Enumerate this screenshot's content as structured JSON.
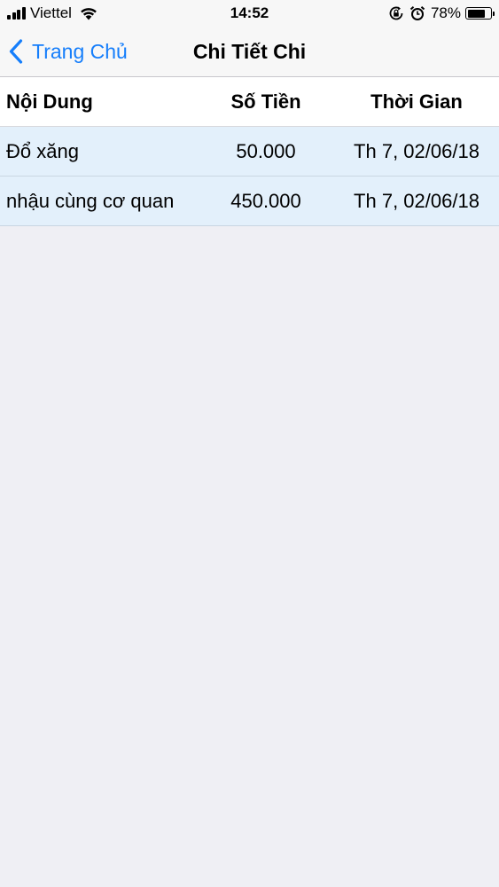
{
  "status_bar": {
    "carrier": "Viettel",
    "time": "14:52",
    "battery_percent": "78%",
    "battery_level": 0.78,
    "signal_icon": "signal-bars-icon",
    "wifi_icon": "wifi-icon",
    "rotation_lock_icon": "rotation-lock-icon",
    "alarm_icon": "alarm-clock-icon",
    "battery_icon": "battery-icon"
  },
  "nav": {
    "back_label": "Trang Chủ",
    "back_icon": "chevron-left-icon",
    "title": "Chi Tiết Chi"
  },
  "table": {
    "headers": {
      "content": "Nội Dung",
      "amount": "Số Tiền",
      "time": "Thời Gian"
    },
    "rows": [
      {
        "content": "Đổ xăng",
        "amount": "50.000",
        "time": "Th 7, 02/06/18"
      },
      {
        "content": "nhậu cùng cơ quan",
        "amount": "450.000",
        "time": "Th 7, 02/06/18"
      }
    ]
  },
  "colors": {
    "accent": "#157efb",
    "row_highlight": "#e3f0fb",
    "background": "#efeff4"
  }
}
